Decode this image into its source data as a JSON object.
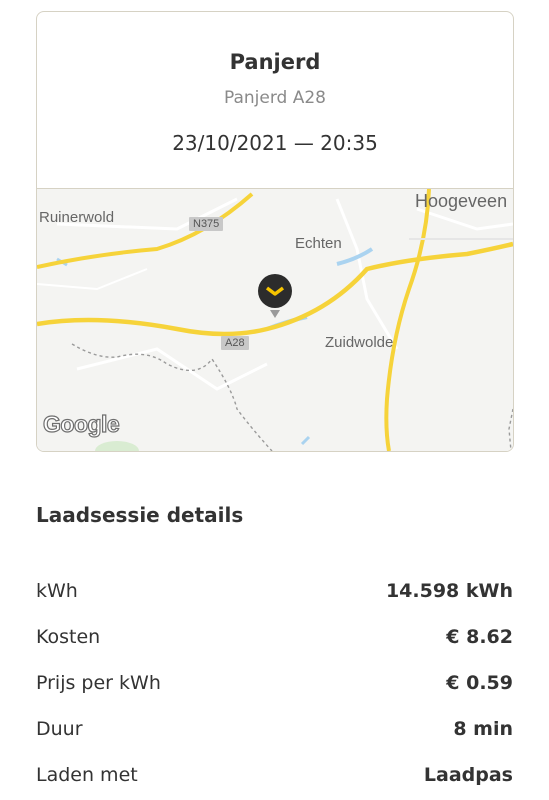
{
  "station": {
    "name": "Panjerd",
    "location": "Panjerd A28",
    "datetime": "23/10/2021 — 20:35"
  },
  "map": {
    "places": [
      "Ruinerwold",
      "Hoogeveen",
      "Echten",
      "Zuidwolde"
    ],
    "road_badges": [
      "N375",
      "A28"
    ],
    "attribution": "Google",
    "colors": {
      "road_major": "#f6d33a",
      "background": "#f4f4f2",
      "water": "#aad3f0",
      "pin": "#2c2c2c",
      "pin_accent": "#f6c400"
    }
  },
  "section": {
    "title": "Laadsessie details"
  },
  "details": [
    {
      "label": "kWh",
      "value": "14.598 kWh"
    },
    {
      "label": "Kosten",
      "value": "€ 8.62"
    },
    {
      "label": "Prijs per kWh",
      "value": "€ 0.59"
    },
    {
      "label": "Duur",
      "value": "8 min"
    },
    {
      "label": "Laden met",
      "value": "Laadpas"
    }
  ]
}
